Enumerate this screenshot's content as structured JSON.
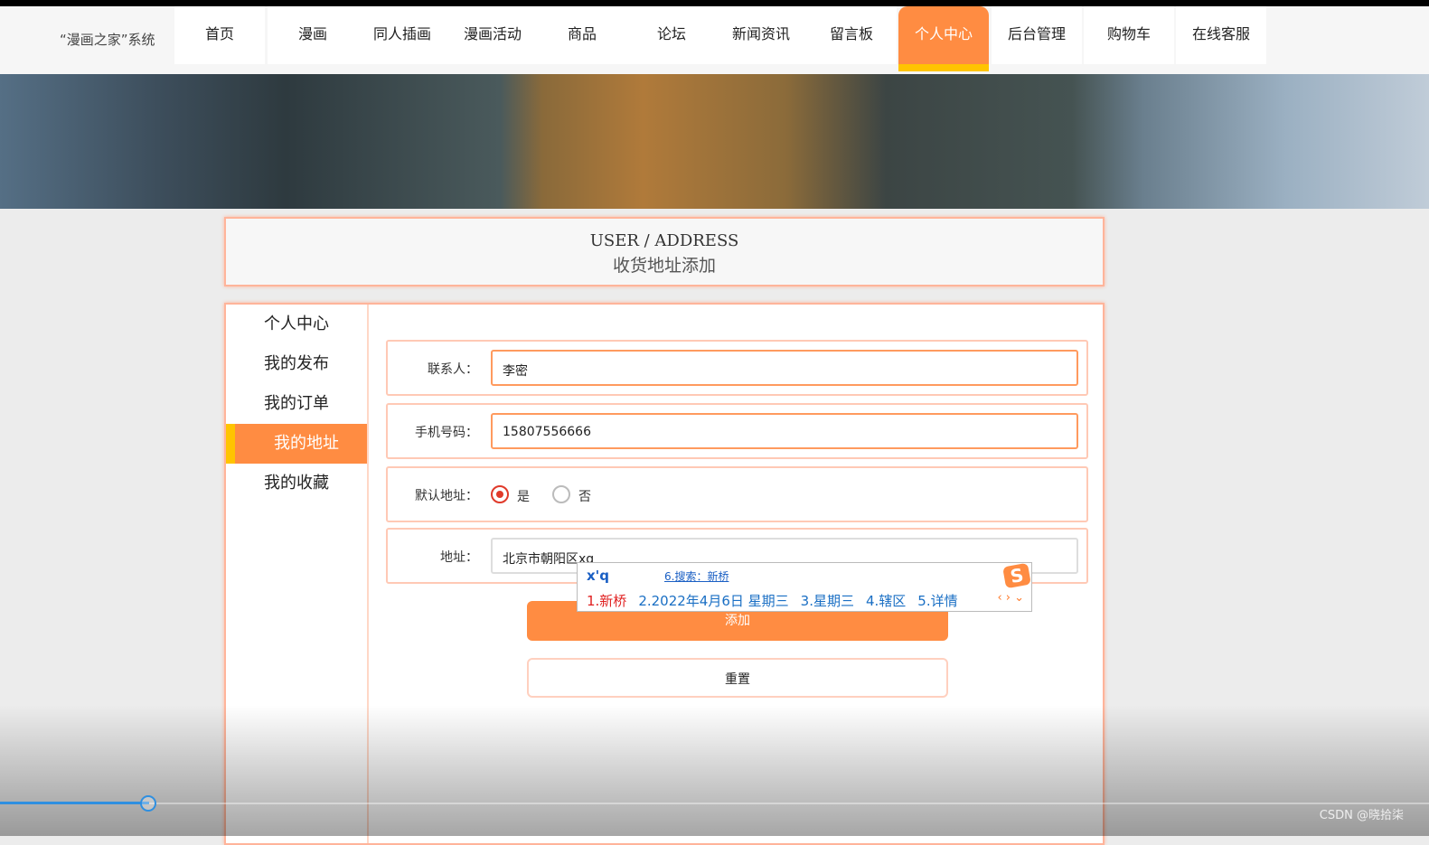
{
  "nav": {
    "logo": "“漫画之家”系统",
    "items": [
      "首页",
      "漫画",
      "同人插画",
      "漫画活动",
      "商品",
      "论坛",
      "新闻资讯",
      "留言板",
      "个人中心",
      "后台管理",
      "购物车",
      "在线客服"
    ],
    "active": "个人中心"
  },
  "header": {
    "en": "USER / ADDRESS",
    "cn": "收货地址添加"
  },
  "sidebar": {
    "items": [
      "个人中心",
      "我的发布",
      "我的订单",
      "我的地址",
      "我的收藏"
    ],
    "active": "我的地址"
  },
  "form": {
    "contact_label": "联系人：",
    "contact_value": "李密",
    "phone_label": "手机号码：",
    "phone_value": "15807556666",
    "default_label": "默认地址：",
    "default_yes": "是",
    "default_no": "否",
    "default_selected": "是",
    "address_label": "地址：",
    "address_value": "北京市朝阳区xq",
    "add_button": "添加",
    "reset_button": "重置"
  },
  "ime": {
    "composition": "x'q",
    "search": "6.搜索：新桥",
    "candidates": [
      "1.新桥",
      "2.2022年4月6日 星期三",
      "3.星期三",
      "4.辖区",
      "5.详情"
    ]
  },
  "colors": {
    "accent": "#ff8c42",
    "highlight": "#ffc400"
  },
  "video": {
    "progress": 0.104,
    "watermark": "CSDN @晓拾柒"
  }
}
